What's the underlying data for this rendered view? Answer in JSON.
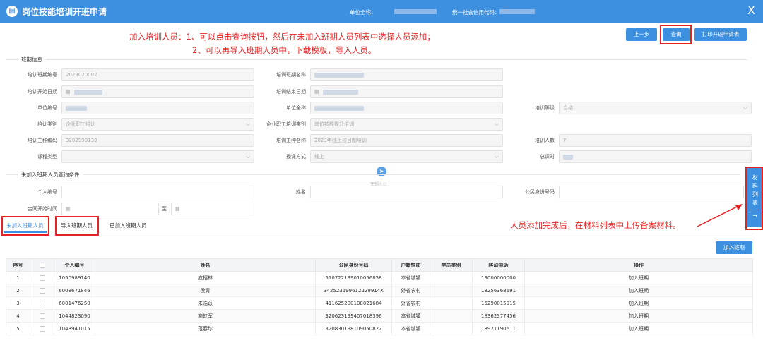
{
  "header": {
    "title": "岗位技能培训开班申请",
    "unit_label": "单位全称：",
    "credit_label": "统一社会信用代码：",
    "close": "X"
  },
  "annotations": {
    "line1": "加入培训人员：1、可以点击查询按钮，然后在未加入班期人员列表中选择人员添加；",
    "line2": "2、可以再导入班期人员中，下载模板，导入人员。",
    "line3": "人员添加完成后，在材料列表中上传备案材料。"
  },
  "toolbar": {
    "prev": "上一步",
    "query": "查询",
    "print": "打印开班申请表"
  },
  "section_info": {
    "title": "班期信息",
    "fields": {
      "class_no_label": "培训班期编号",
      "class_no": "2023020002",
      "class_name_label": "培训班期名称",
      "start_label": "培训开始日期",
      "end_label": "培训结束日期",
      "unit_no_label": "单位编号",
      "unit_name_label": "单位全称",
      "level_label": "培训等级",
      "level": "合格",
      "type_label": "培训类别",
      "type": "企业职工培训",
      "ent_type_label": "企业职工培训类别",
      "ent_type": "岗位技能提升培训",
      "job_code_label": "培训工种编码",
      "job_code": "3202990133",
      "job_name_label": "培训工种名称",
      "job_name": "2023年线上项目制培训",
      "count_label": "培训人数",
      "count": "7",
      "course_type_label": "课程类型",
      "teach_label": "授课方式",
      "teach": "线上",
      "hours_label": "总课时"
    }
  },
  "section_query": {
    "title": "未加入班期人员查询条件",
    "person_no_label": "个人编号",
    "name_label": "姓名",
    "id_label": "公民身份号码",
    "contract_label": "合同开始时间",
    "to": "至"
  },
  "watermark": "无锡人社",
  "sidetab": [
    "材",
    "料",
    "列",
    "表"
  ],
  "tabs": {
    "not_joined": "未加入班期人员",
    "import": "导入班期人员",
    "joined": "已加入班期人员"
  },
  "add_button": "加入班期",
  "table": {
    "headers": [
      "序号",
      "",
      "个人编号",
      "姓名",
      "公民身份号码",
      "户籍性质",
      "学员类别",
      "移动电话",
      "操作"
    ],
    "rows": [
      {
        "no": "1",
        "pid": "1050989140",
        "name": "应招林",
        "idno": "510722199010056858",
        "hukou": "本省城镇",
        "cat": "",
        "phone": "13000000000",
        "op": "加入班期"
      },
      {
        "no": "2",
        "pid": "6003671846",
        "name": "侯青",
        "idno": "342523199612229914X",
        "hukou": "外省农村",
        "cat": "",
        "phone": "18256368691",
        "op": "加入班期"
      },
      {
        "no": "3",
        "pid": "6001476250",
        "name": "朱浩苡",
        "idno": "411625200108021684",
        "hukou": "外省农村",
        "cat": "",
        "phone": "15290015915",
        "op": "加入班期"
      },
      {
        "no": "4",
        "pid": "1044823090",
        "name": "施虹军",
        "idno": "320623199407018396",
        "hukou": "本省城镇",
        "cat": "",
        "phone": "18362377456",
        "op": "加入班期"
      },
      {
        "no": "5",
        "pid": "1048941015",
        "name": "范春珍",
        "idno": "320830198109050822",
        "hukou": "本省城镇",
        "cat": "",
        "phone": "18921190611",
        "op": "加入班期"
      }
    ]
  },
  "colors": {
    "primary": "#3d8fdf",
    "annotation": "#e52323"
  }
}
